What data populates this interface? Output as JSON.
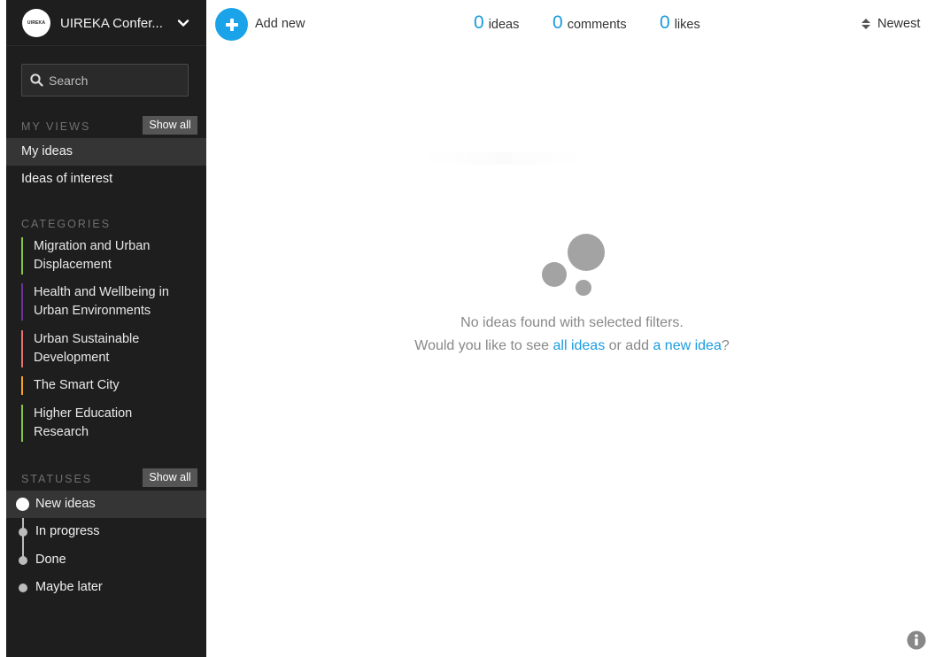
{
  "brand": {
    "logo_text": "UIREKA",
    "name": "UIREKA Confer..."
  },
  "search": {
    "placeholder": "Search"
  },
  "my_views": {
    "title": "MY VIEWS",
    "show_all": "Show all",
    "items": [
      {
        "label": "My ideas",
        "active": true
      },
      {
        "label": "Ideas of interest",
        "active": false
      }
    ]
  },
  "categories": {
    "title": "CATEGORIES",
    "items": [
      {
        "line1": "Migration and Urban",
        "line2": "Displacement",
        "color": "#8bc34a"
      },
      {
        "line1": "Health and Wellbeing in",
        "line2": "Urban Environments",
        "color": "#7b3fa0"
      },
      {
        "line1": "Urban Sustainable",
        "line2": "Development",
        "color": "#e57373"
      },
      {
        "line1": "The Smart City",
        "line2": "",
        "color": "#f5a623"
      },
      {
        "line1": "Higher Education",
        "line2": "Research",
        "color": "#8bc34a"
      }
    ]
  },
  "statuses": {
    "title": "STATUSES",
    "show_all": "Show all",
    "items": [
      {
        "label": "New ideas",
        "active": true
      },
      {
        "label": "In progress",
        "active": false
      },
      {
        "label": "Done",
        "active": false
      },
      {
        "label": "Maybe later",
        "active": false
      }
    ]
  },
  "toolbar": {
    "add_new": "Add new",
    "stats": [
      {
        "value": "0",
        "label": "ideas"
      },
      {
        "value": "0",
        "label": "comments"
      },
      {
        "value": "0",
        "label": "likes"
      }
    ],
    "sort_label": "Newest"
  },
  "empty_state": {
    "line1": "No ideas found with selected filters.",
    "line2_prefix": "Would you like to see ",
    "link_all": "all ideas",
    "line2_mid": " or add ",
    "link_new": "a new idea",
    "line2_suffix": "?"
  },
  "colors": {
    "accent": "#1a9be0",
    "sidebar_bg": "#1e1e1e"
  },
  "icons": [
    "search-icon",
    "chevron-down-icon",
    "plus-icon",
    "sort-icon",
    "info-icon",
    "empty-bubbles-icon"
  ]
}
